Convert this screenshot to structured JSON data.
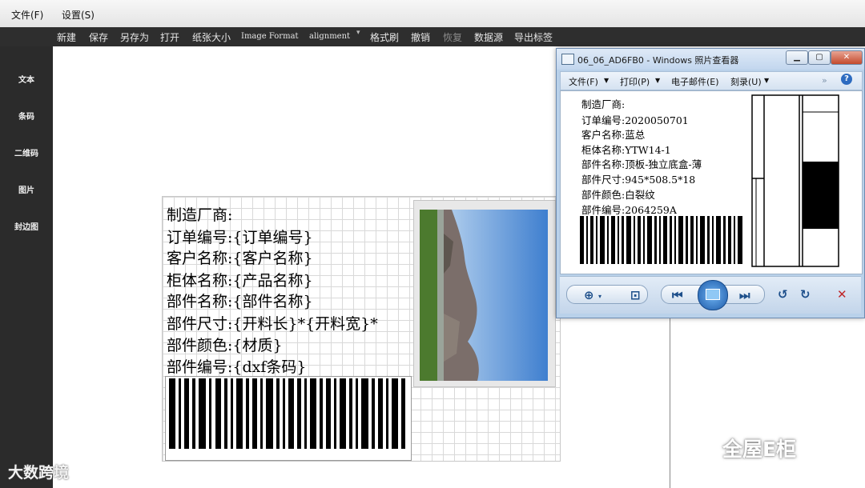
{
  "menubar": {
    "file": "文件(F)",
    "settings": "设置(S)"
  },
  "toolbar": {
    "new": "新建",
    "save": "保存",
    "save_as": "另存为",
    "print": "打开",
    "paper_size": "纸张大小",
    "image_format": "Image Format",
    "alignment": "alignment",
    "format_brush": "格式刷",
    "undo": "撤销",
    "redo": "恢复",
    "data_source": "数据源",
    "export_label": "导出标签"
  },
  "sidebar": {
    "text": "文本",
    "barcode": "条码",
    "qrcode": "二维码",
    "image": "图片",
    "edge_code": "封边图"
  },
  "label": {
    "lines": [
      "制造厂商:",
      "订单编号:{订单编号}",
      "客户名称:{客户名称}",
      "柜体名称:{产品名称}",
      "部件名称:{部件名称}",
      "部件尺寸:{开料长}*{开料宽}*",
      "部件颜色:{材质}",
      "部件编号:{dxf条码}"
    ]
  },
  "viewer": {
    "title": "06_06_AD6FB0 - Windows 照片查看器",
    "menu": {
      "file": "文件(F)",
      "print": "打印(P)",
      "email": "电子邮件(E)",
      "burn": "刻录(U)"
    },
    "lines": [
      "制造厂商:",
      "订单编号:2020050701",
      "客户名称:蓝总",
      "柜体名称:YTW14-1",
      "部件名称:顶板-独立底盒-薄",
      "部件尺寸:945*508.5*18",
      "部件颜色:白裂纹",
      "部件编号:2064259A"
    ]
  },
  "watermarks": {
    "right": "全屋E柜",
    "left": "大数跨境"
  },
  "icons": {
    "viewer_app": "photo-viewer-icon",
    "zoom": "zoom-icon",
    "fit": "fit-window-icon",
    "prev": "previous-icon",
    "slideshow": "slideshow-icon",
    "next": "next-icon",
    "rotate_left": "rotate-ccw-icon",
    "rotate_right": "rotate-cw-icon",
    "delete": "delete-icon",
    "help": "help-icon"
  },
  "colors": {
    "toolbar_bg": "#2e2e2e",
    "sidebar_bg": "#2b2b2b",
    "viewer_chrome": "#b9d1ea",
    "delete_red": "#c0282a"
  }
}
